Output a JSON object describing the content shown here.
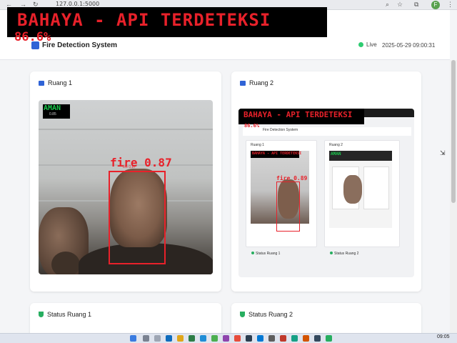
{
  "browser": {
    "url": "127.0.0.1:5000",
    "nav_icons": [
      "back-icon",
      "forward-icon",
      "reload-icon"
    ],
    "avatar_initial": "F"
  },
  "header": {
    "title": "Fire Detection System",
    "status": "Live",
    "datetime": "2025-05-29 09:00:31"
  },
  "overlay": {
    "alert_text": "BAHAYA - API TERDETEKSI",
    "percent": "86.6%"
  },
  "rooms": [
    {
      "title": "Ruang 1",
      "safe_label": "AMAN",
      "safe_sub": "0.85",
      "detection_label": "fire 0.87",
      "detection_small": "fire 0.87"
    },
    {
      "title": "Ruang 2",
      "inner_alert": "BAHAYA - API TERDETEKSI",
      "inner_pct": "86.6%",
      "inner_title": "Fire Detection System",
      "inner_card1": "Ruang 1",
      "inner_card2": "Ruang 2",
      "inner_alert_small": "BAHAYA - API TERDETEKSI",
      "inner_detection": "fire 0.89",
      "inner_aman": "AMAN",
      "inner_status1": "Status Ruang 1",
      "inner_status2": "Status Ruang 2"
    }
  ],
  "status_cards": [
    {
      "title": "Status Ruang 1"
    },
    {
      "title": "Status Ruang 2"
    }
  ],
  "taskbar": {
    "time": "09:05"
  },
  "colors": {
    "alert": "#e8212a",
    "safe": "#19c94c",
    "accent": "#2f63d6",
    "status_ok": "#27ae60"
  }
}
